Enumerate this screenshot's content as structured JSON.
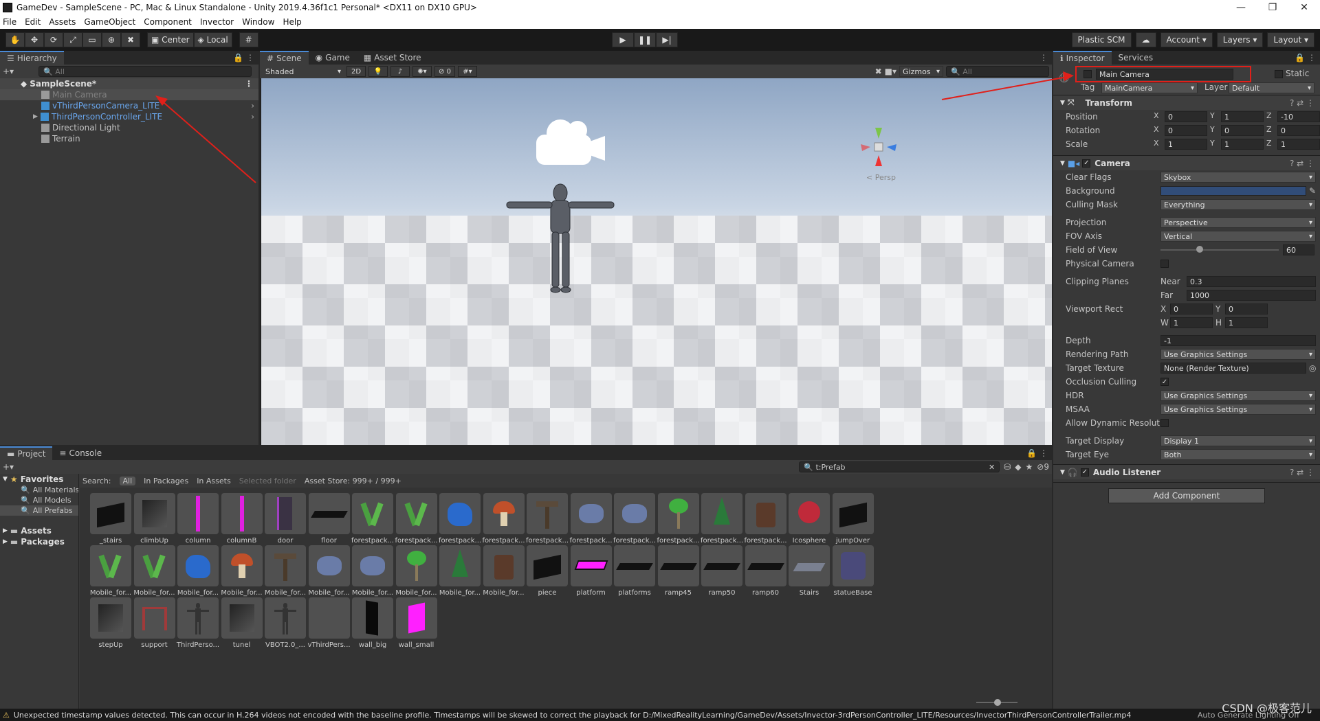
{
  "window": {
    "title": "GameDev - SampleScene - PC, Mac & Linux Standalone - Unity 2019.4.36f1c1 Personal* <DX11 on DX10 GPU>",
    "controls": [
      "—",
      "❐",
      "✕"
    ]
  },
  "menu": [
    "File",
    "Edit",
    "Assets",
    "GameObject",
    "Component",
    "Invector",
    "Window",
    "Help"
  ],
  "toolbar": {
    "pivot": "Center",
    "space": "Local",
    "plastic": "Plastic SCM",
    "account": "Account",
    "layers": "Layers",
    "layout": "Layout"
  },
  "hierarchy": {
    "tab": "Hierarchy",
    "search_placeholder": "All",
    "scene": "SampleScene*",
    "items": [
      {
        "label": "Main Camera",
        "style": "selected"
      },
      {
        "label": "vThirdPersonCamera_LITE",
        "style": "prefab"
      },
      {
        "label": "ThirdPersonController_LITE",
        "style": "prefab"
      },
      {
        "label": "Directional Light",
        "style": "normal"
      },
      {
        "label": "Terrain",
        "style": "normal"
      }
    ]
  },
  "scene": {
    "tabs": [
      "Scene",
      "Game",
      "Asset Store"
    ],
    "shading": "Shaded",
    "mode2d": "2D",
    "fx_count": "0",
    "gizmos": "Gizmos",
    "search_placeholder": "All",
    "persp_label": "< Persp"
  },
  "inspector": {
    "tabs": [
      "Inspector",
      "Services"
    ],
    "object_name": "Main Camera",
    "static_label": "Static",
    "tag_label": "Tag",
    "tag_value": "MainCamera",
    "layer_label": "Layer",
    "layer_value": "Default",
    "transform": {
      "title": "Transform",
      "position_label": "Position",
      "rotation_label": "Rotation",
      "scale_label": "Scale",
      "position": [
        "0",
        "1",
        "-10"
      ],
      "rotation": [
        "0",
        "0",
        "0"
      ],
      "scale": [
        "1",
        "1",
        "1"
      ]
    },
    "camera": {
      "title": "Camera",
      "clear_flags_label": "Clear Flags",
      "clear_flags": "Skybox",
      "background_label": "Background",
      "background_color": "#314d79",
      "culling_mask_label": "Culling Mask",
      "culling_mask": "Everything",
      "projection_label": "Projection",
      "projection": "Perspective",
      "fov_axis_label": "FOV Axis",
      "fov_axis": "Vertical",
      "fov_label": "Field of View",
      "fov": "60",
      "fov_fraction": 0.33,
      "physical_label": "Physical Camera",
      "clipping_label": "Clipping Planes",
      "near_label": "Near",
      "near": "0.3",
      "far_label": "Far",
      "far": "1000",
      "viewport_label": "Viewport Rect",
      "vx": "0",
      "vy": "0",
      "vw": "1",
      "vh": "1",
      "depth_label": "Depth",
      "depth": "-1",
      "rendering_path_label": "Rendering Path",
      "rendering_path": "Use Graphics Settings",
      "target_texture_label": "Target Texture",
      "target_texture": "None (Render Texture)",
      "occlusion_label": "Occlusion Culling",
      "hdr_label": "HDR",
      "hdr": "Use Graphics Settings",
      "msaa_label": "MSAA",
      "msaa": "Use Graphics Settings",
      "dynres_label": "Allow Dynamic Resolutio",
      "target_display_label": "Target Display",
      "target_display": "Display 1",
      "target_eye_label": "Target Eye",
      "target_eye": "Both"
    },
    "audio": {
      "title": "Audio Listener"
    },
    "add_component": "Add Component"
  },
  "project": {
    "tabs": [
      "Project",
      "Console"
    ],
    "search_value": "t:Prefab",
    "hidden_count": "9",
    "search_label": "Search:",
    "scopes": [
      "All",
      "In Packages",
      "In Assets",
      "Selected folder",
      "Asset Store: 999+ / 999+"
    ],
    "favorites": "Favorites",
    "fav_items": [
      "All Materials",
      "All Models",
      "All Prefabs"
    ],
    "folders": [
      "Assets",
      "Packages"
    ],
    "assets": [
      {
        "name": "_stairs",
        "shape": "dark"
      },
      {
        "name": "climbUp",
        "shape": "cube"
      },
      {
        "name": "column",
        "shape": "magenta-pole"
      },
      {
        "name": "columnB",
        "shape": "magenta-pole"
      },
      {
        "name": "door",
        "shape": "door"
      },
      {
        "name": "floor",
        "shape": "flat"
      },
      {
        "name": "forestpack...",
        "shape": "grass"
      },
      {
        "name": "forestpack...",
        "shape": "grass"
      },
      {
        "name": "forestpack...",
        "shape": "blue-rock"
      },
      {
        "name": "forestpack...",
        "shape": "mushroom"
      },
      {
        "name": "forestpack...",
        "shape": "sign"
      },
      {
        "name": "forestpack...",
        "shape": "rock"
      },
      {
        "name": "forestpack...",
        "shape": "rock"
      },
      {
        "name": "forestpack...",
        "shape": "tree-round"
      },
      {
        "name": "forestpack...",
        "shape": "pine"
      },
      {
        "name": "forestpack...",
        "shape": "stump"
      },
      {
        "name": "Icosphere",
        "shape": "red-ball"
      },
      {
        "name": "jumpOver",
        "shape": "dark"
      },
      {
        "name": "Mobile_for...",
        "shape": "grass"
      },
      {
        "name": "Mobile_for...",
        "shape": "grass"
      },
      {
        "name": "Mobile_for...",
        "shape": "blue-rock"
      },
      {
        "name": "Mobile_for...",
        "shape": "mushroom"
      },
      {
        "name": "Mobile_for...",
        "shape": "sign"
      },
      {
        "name": "Mobile_for...",
        "shape": "rock"
      },
      {
        "name": "Mobile_for...",
        "shape": "rock"
      },
      {
        "name": "Mobile_for...",
        "shape": "tree-round"
      },
      {
        "name": "Mobile_for...",
        "shape": "pine"
      },
      {
        "name": "Mobile_for...",
        "shape": "stump"
      },
      {
        "name": "piece",
        "shape": "dark"
      },
      {
        "name": "platform",
        "shape": "platform"
      },
      {
        "name": "platforms",
        "shape": "flat"
      },
      {
        "name": "ramp45",
        "shape": "flat"
      },
      {
        "name": "ramp50",
        "shape": "flat"
      },
      {
        "name": "ramp60",
        "shape": "flat"
      },
      {
        "name": "Stairs",
        "shape": "stairs"
      },
      {
        "name": "statueBase",
        "shape": "statue"
      },
      {
        "name": "stepUp",
        "shape": "cube"
      },
      {
        "name": "support",
        "shape": "support"
      },
      {
        "name": "ThirdPerso...",
        "shape": "figure"
      },
      {
        "name": "tunel",
        "shape": "cube"
      },
      {
        "name": "VBOT2.0_...",
        "shape": "figure"
      },
      {
        "name": "vThirdPers...",
        "shape": "empty"
      },
      {
        "name": "wall_big",
        "shape": "wall"
      },
      {
        "name": "wall_small",
        "shape": "magenta-wall"
      }
    ]
  },
  "status": {
    "message": "Unexpected timestamp values detected. This can occur in H.264 videos not encoded with the baseline profile. Timestamps will be skewed to correct the playback for D:/MixedRealityLearning/GameDev/Assets/Invector-3rdPersonController_LITE/Resources/InvectorThirdPersonControllerTrailer.mp4",
    "right": "Auto Generate Lighting Off",
    "watermark": "CSDN @极客范儿"
  }
}
